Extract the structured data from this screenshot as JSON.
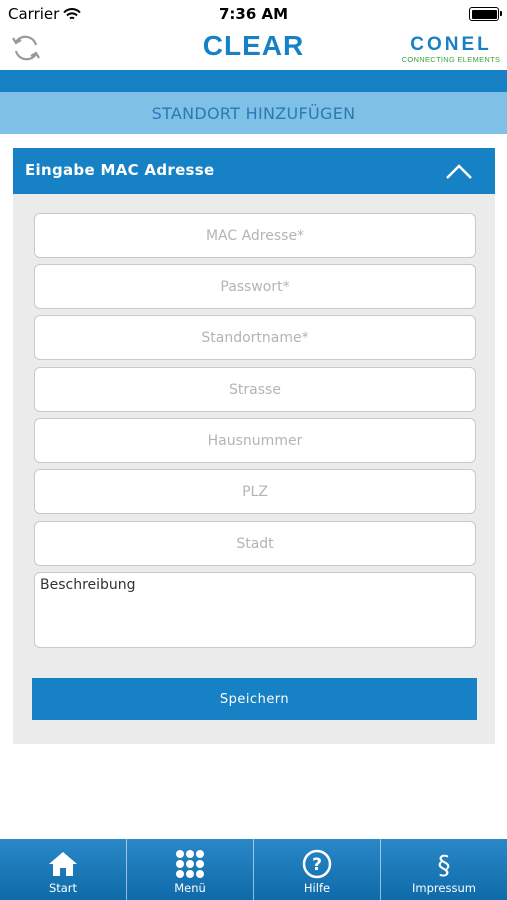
{
  "status_bar": {
    "carrier": "Carrier",
    "time": "7:36 AM"
  },
  "header": {
    "title": "CLEAR",
    "logo_brand": "CONEL",
    "logo_tagline": "CONNECTING ELEMENTS"
  },
  "subtitle": "STANDORT HINZUFÜGEN",
  "panel": {
    "title": "Eingabe MAC Adresse",
    "fields": {
      "mac": "MAC Adresse*",
      "password": "Passwort*",
      "location_name": "Standortname*",
      "street": "Strasse",
      "house_number": "Hausnummer",
      "zip": "PLZ",
      "city": "Stadt",
      "description": "Beschreibung"
    },
    "save_label": "Speichern"
  },
  "tabs": [
    {
      "label": "Start",
      "icon": "home-icon"
    },
    {
      "label": "Menü",
      "icon": "grid-icon"
    },
    {
      "label": "Hilfe",
      "icon": "help-icon"
    },
    {
      "label": "Impressum",
      "icon": "section-icon"
    }
  ],
  "colors": {
    "primary": "#1681c4",
    "subtitle_bg": "#7fc0e6",
    "panel_bg": "#ebebeb",
    "logo_green": "#3aa23a"
  }
}
